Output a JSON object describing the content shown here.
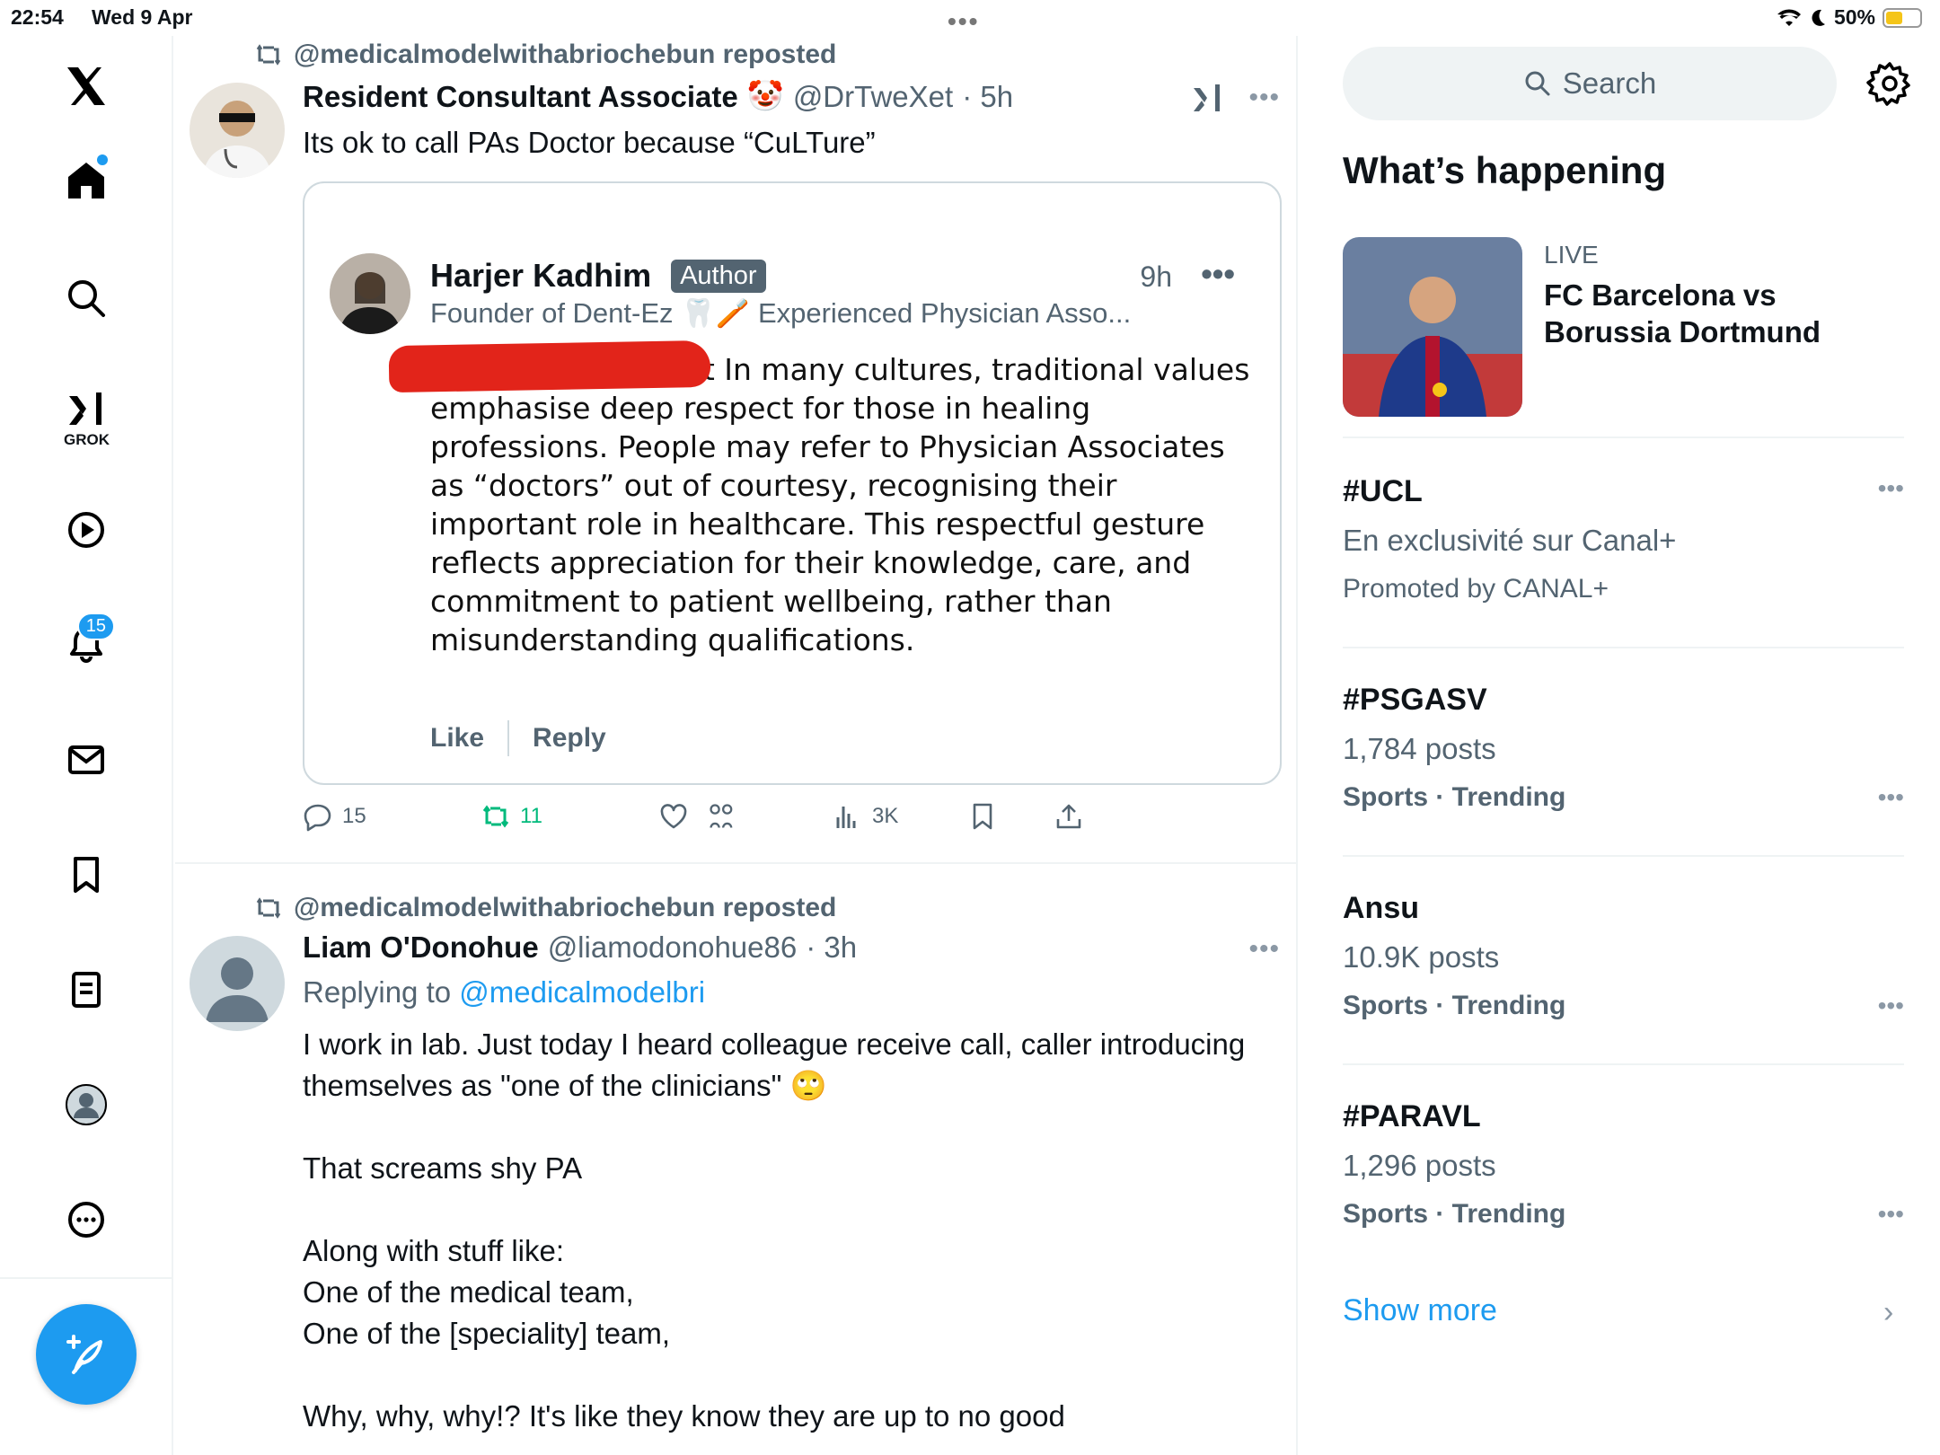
{
  "status": {
    "time": "22:54",
    "date": "Wed 9 Apr",
    "battery": "50%",
    "battery_level": 0.5,
    "multitask": "•••"
  },
  "nav": {
    "grok_label": "GROK",
    "notifications_count": "15"
  },
  "tweets": [
    {
      "repost_by": "@medicalmodelwithabriochebun reposted",
      "name": "Resident Consultant Associate",
      "name_emoji": "🤡",
      "handle": "@DrTweXet",
      "time": "· 5h",
      "text": "Its ok to call PAs Doctor because “CuLTure”",
      "quote": {
        "name": "Harjer Kadhim",
        "badge": "Author",
        "time": "9h",
        "bio": "Founder of Dent-Ez 🦷🪥 Experienced Physician Asso...",
        "body_prefix": "ir",
        "body": " understands that In many cultures, traditional values emphasise deep respect for those in healing professions. People may refer to Physician Associates as “doctors” out of courtesy, recognising their important role in healthcare. This respectful gesture reflects appreciation for their knowledge, care, and commitment to patient wellbeing, rather than misunderstanding qualifications.",
        "like": "Like",
        "reply": "Reply"
      },
      "replies": "15",
      "reposts": "11",
      "likes": "",
      "views": "3K"
    },
    {
      "repost_by": "@medicalmodelwithabriochebun reposted",
      "name": "Liam O'Donohue",
      "handle": "@liamodonohue86",
      "time": "· 3h",
      "replying_prefix": "Replying to ",
      "replying_to": "@medicalmodelbri",
      "text": "I work in lab. Just today I heard colleague receive call, caller introducing themselves as \"one of the clinicians\" 🙄\n\nThat screams shy PA\n\nAlong with stuff like:\nOne of the medical team,\nOne of the [speciality] team,\n\nWhy, why, why!? It's like they know they are up to no good"
    }
  ],
  "sidebar": {
    "search_placeholder": "Search",
    "section_title": "What’s happening",
    "feature": {
      "live": "LIVE",
      "title": "FC Barcelona vs Borussia Dortmund"
    },
    "trends": [
      {
        "title": "#UCL",
        "sub": "En exclusivité sur Canal+",
        "meta": "Promoted by CANAL+"
      },
      {
        "title": "#PSGASV",
        "sub": "1,784 posts",
        "meta": "Sports · Trending"
      },
      {
        "title": "Ansu",
        "sub": "10.9K posts",
        "meta": "Sports · Trending"
      },
      {
        "title": "#PARAVL",
        "sub": "1,296 posts",
        "meta": "Sports · Trending"
      }
    ],
    "show_more": "Show more"
  }
}
